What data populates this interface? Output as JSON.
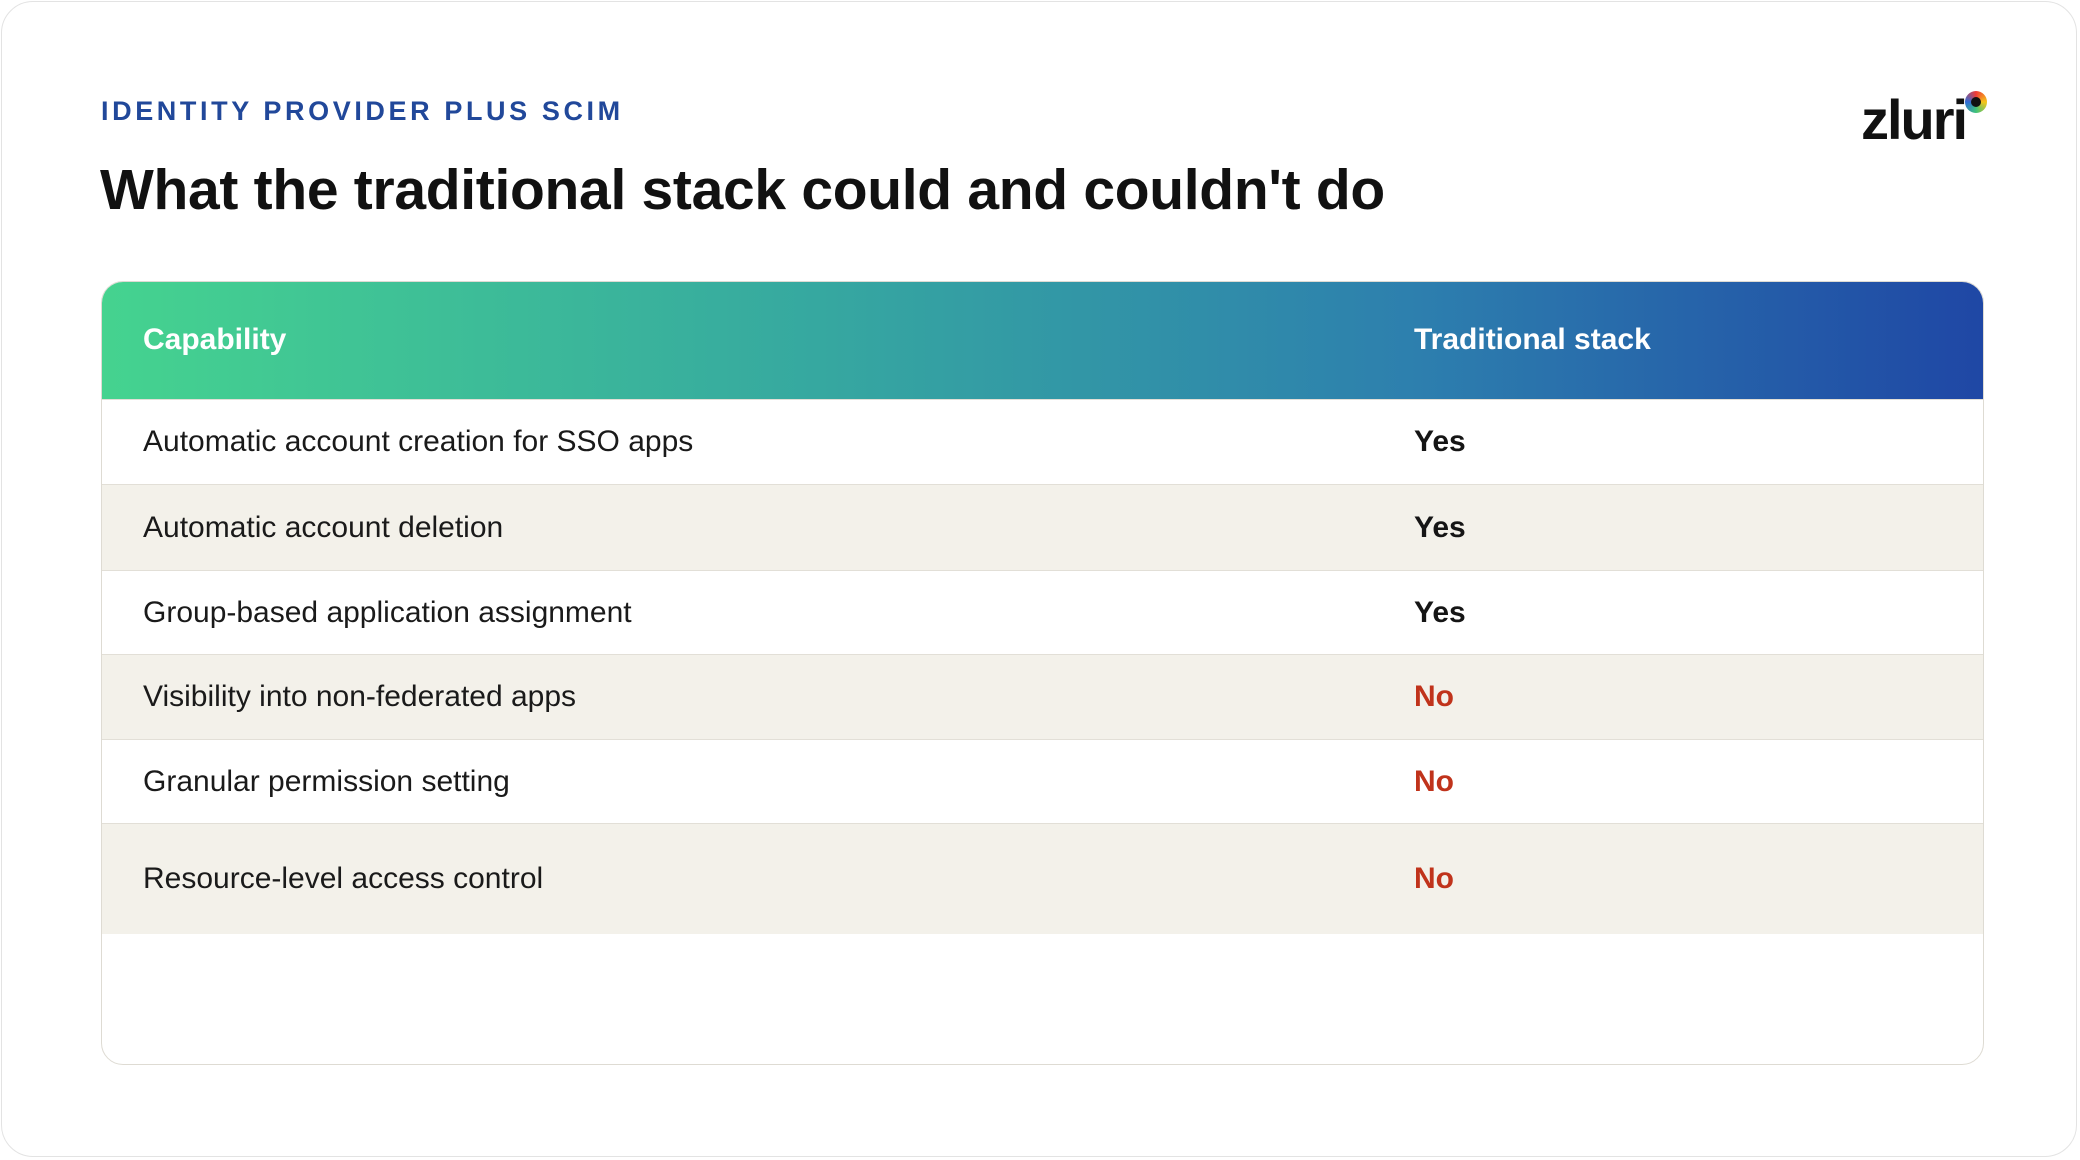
{
  "header": {
    "eyebrow": "IDENTITY PROVIDER PLUS SCIM",
    "title": "What the traditional stack could and couldn't do"
  },
  "logo": {
    "text": "zluri"
  },
  "table": {
    "columns": [
      "Capability",
      "Traditional stack"
    ],
    "rows": [
      {
        "capability": "Automatic account creation for SSO apps",
        "value": "Yes",
        "status": "positive"
      },
      {
        "capability": "Automatic account deletion",
        "value": "Yes",
        "status": "positive"
      },
      {
        "capability": "Group-based application assignment",
        "value": "Yes",
        "status": "positive"
      },
      {
        "capability": "Visibility into non-federated apps",
        "value": "No",
        "status": "negative"
      },
      {
        "capability": "Granular permission setting",
        "value": "No",
        "status": "negative"
      },
      {
        "capability": "Resource-level access control",
        "value": "No",
        "status": "negative"
      }
    ]
  },
  "colors": {
    "accent_blue": "#21489a",
    "header_gradient_start": "#45d38f",
    "header_gradient_end": "#1f47a5",
    "positive": "#151515",
    "negative": "#c0331b",
    "alt_row": "#f3f1ea"
  }
}
